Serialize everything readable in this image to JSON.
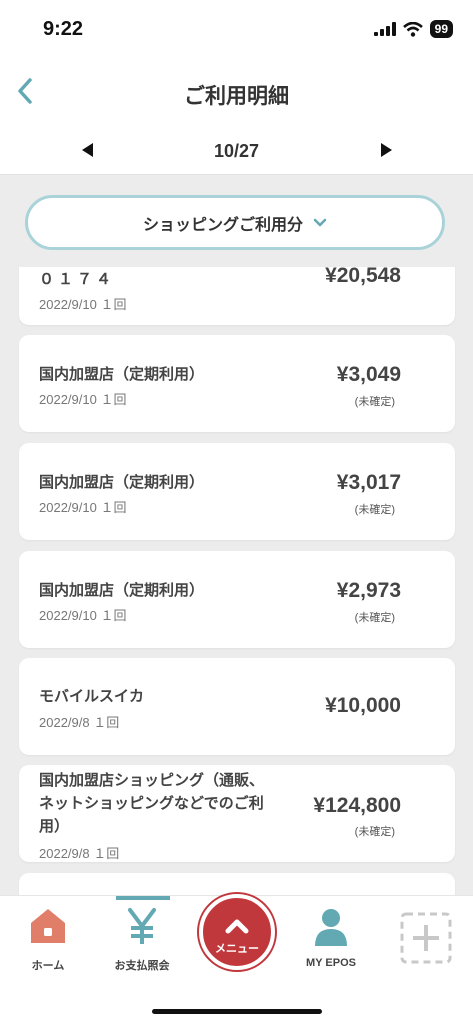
{
  "status_bar": {
    "time": "9:22",
    "battery": "99"
  },
  "header": {
    "title": "ご利用明細"
  },
  "pager": {
    "label": "10/27"
  },
  "category": {
    "label": "ショッピングご利用分"
  },
  "transactions": [
    {
      "name": "０１７４",
      "date": "2022/9/10",
      "count": "１回",
      "amount": "¥20,548",
      "status": ""
    },
    {
      "name": "国内加盟店（定期利用）",
      "date": "2022/9/10",
      "count": "１回",
      "amount": "¥3,049",
      "status": "(未確定)"
    },
    {
      "name": "国内加盟店（定期利用）",
      "date": "2022/9/10",
      "count": "１回",
      "amount": "¥3,017",
      "status": "(未確定)"
    },
    {
      "name": "国内加盟店（定期利用）",
      "date": "2022/9/10",
      "count": "１回",
      "amount": "¥2,973",
      "status": "(未確定)"
    },
    {
      "name": "モバイルスイカ",
      "date": "2022/9/8",
      "count": "１回",
      "amount": "¥10,000",
      "status": ""
    },
    {
      "name": "国内加盟店ショッピング（通販、ネットショッピングなどでのご利用）",
      "name_lines": [
        "国内加盟店ショッピング（通販、",
        "ネットショッピングなどでのご利",
        "用）"
      ],
      "date": "2022/9/8",
      "count": "１回",
      "amount": "¥124,800",
      "status": "(未確定)"
    }
  ],
  "tabbar": {
    "home": "ホーム",
    "payment": "お支払照会",
    "menu": "メニュー",
    "myepos": "MY EPOS"
  },
  "colors": {
    "accent": "#63a9b4",
    "menu_red": "#c1383c",
    "background": "#ececed"
  }
}
